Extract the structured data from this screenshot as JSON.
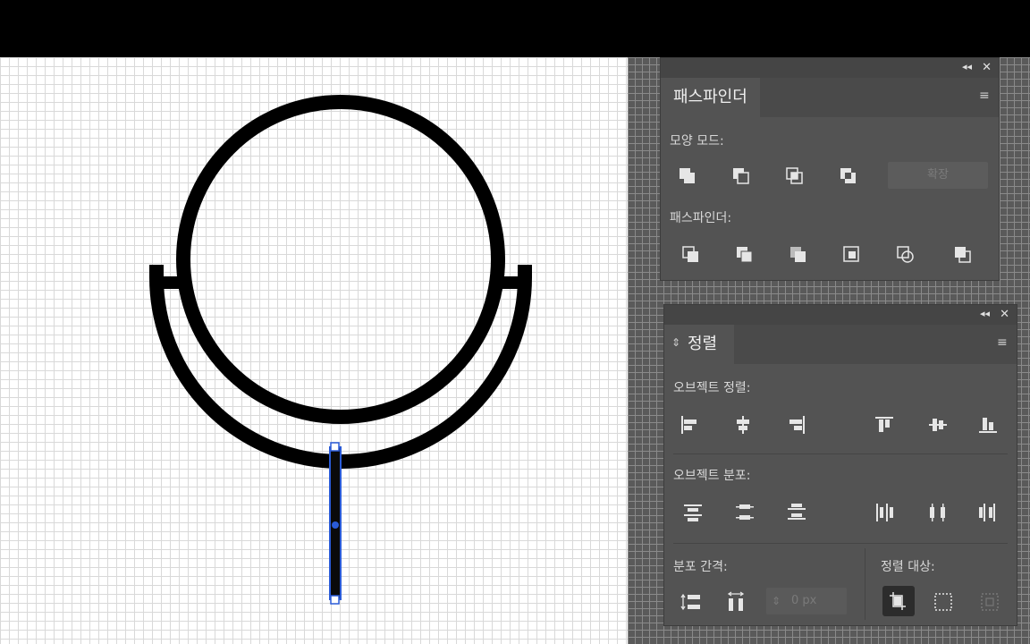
{
  "pathfinder_panel": {
    "tab_label": "패스파인더",
    "shape_modes_label": "모양 모드:",
    "pathfinders_label": "패스파인더:",
    "apply_label": "확장"
  },
  "align_panel": {
    "tab_label": "정렬",
    "align_objects_label": "오브젝트 정렬:",
    "distribute_objects_label": "오브젝트 분포:",
    "distribute_spacing_label": "분포 간격:",
    "align_to_label": "정렬 대상:",
    "spacing_value": "0 px"
  },
  "colors": {
    "canvas": "#ffffff",
    "panel_bg": "#535353",
    "selection": "#2a5bd7"
  }
}
